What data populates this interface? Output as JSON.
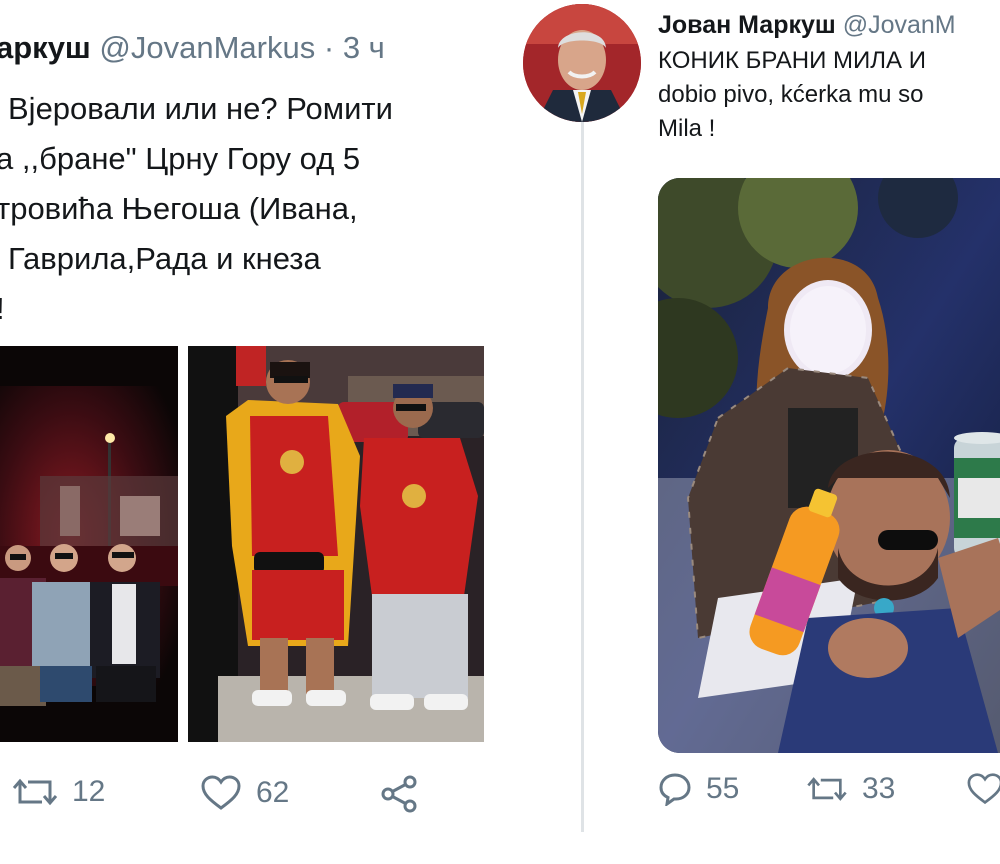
{
  "left_tweet": {
    "author": "аркуш",
    "handle": "@JovanMarkus",
    "separator": "·",
    "time": "3 ч",
    "lines": [
      "Вјеровали или не? Ромити",
      "а ,,бране\" Црну Гору од 5",
      "тровића Његоша (Ивана,",
      "Гаврила,Рада и кнеза",
      "!"
    ],
    "retweets": "12",
    "likes": "62"
  },
  "right_tweet": {
    "author": "Јован Маркуш",
    "handle": "@JovanM",
    "lines": [
      "КОНИК БРАНИ МИЛА И",
      "dobio pivo, kćerka mu so",
      "Mila !"
    ],
    "replies": "55",
    "retweets": "33"
  },
  "icons": {
    "retweet": "retweet-icon",
    "like": "heart-icon",
    "share": "share-icon",
    "reply": "reply-icon"
  },
  "colors": {
    "text": "#14171a",
    "secondary": "#657786",
    "shirt_red": "#c8201f",
    "divider": "#dfe3e6"
  }
}
